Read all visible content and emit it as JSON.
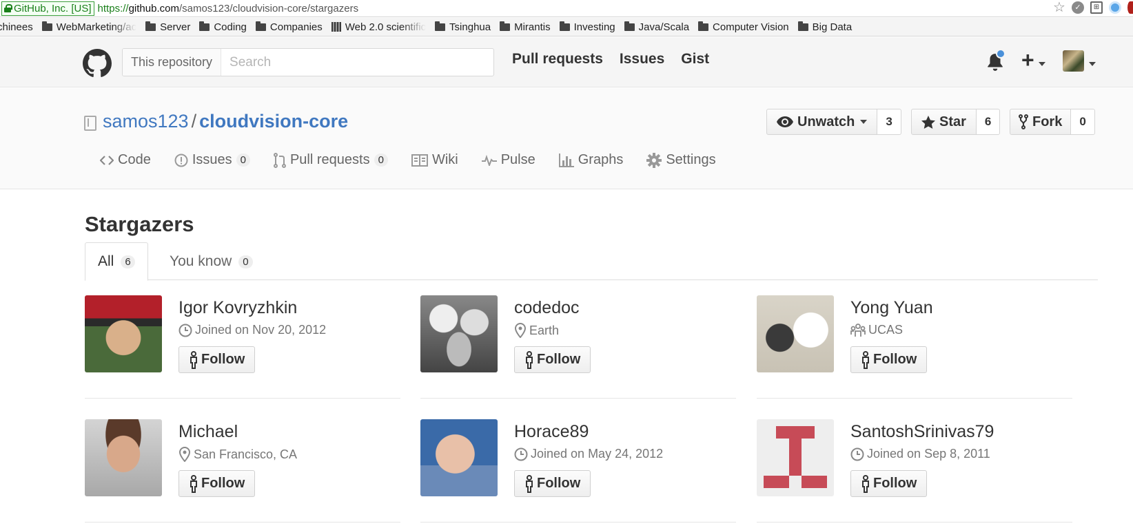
{
  "browser": {
    "secure_label": "GitHub, Inc. [US]",
    "url_scheme": "https://",
    "url_host": "github.com",
    "url_path": "/samos123/cloudvision-core/stargazers",
    "bookmarks": [
      "chinees",
      "WebMarketing/ac",
      "Server",
      "Coding",
      "Companies",
      "Web 2.0 scientific",
      "Tsinghua",
      "Mirantis",
      "Investing",
      "Java/Scala",
      "Computer Vision",
      "Big Data"
    ]
  },
  "header": {
    "search_scope": "This repository",
    "search_placeholder": "Search",
    "nav": [
      "Pull requests",
      "Issues",
      "Gist"
    ],
    "plus_label": "+"
  },
  "repo": {
    "owner": "samos123",
    "separator": "/",
    "name": "cloudvision-core",
    "watch_label": "Unwatch",
    "watch_count": "3",
    "star_label": "Star",
    "star_count": "6",
    "fork_label": "Fork",
    "fork_count": "0",
    "tabs": {
      "code": "Code",
      "issues": "Issues",
      "issues_count": "0",
      "pulls": "Pull requests",
      "pulls_count": "0",
      "wiki": "Wiki",
      "pulse": "Pulse",
      "graphs": "Graphs",
      "settings": "Settings"
    }
  },
  "stargazers": {
    "title": "Stargazers",
    "tab_all": "All",
    "tab_all_count": "6",
    "tab_known": "You know",
    "tab_known_count": "0",
    "follow_label": "Follow",
    "users": [
      {
        "name": "Igor Kovryzhkin",
        "meta": "Joined on Nov 20, 2012",
        "meta_icon": "clock-icon"
      },
      {
        "name": "codedoc",
        "meta": "Earth",
        "meta_icon": "location-icon"
      },
      {
        "name": "Yong Yuan",
        "meta": "UCAS",
        "meta_icon": "organization-icon"
      },
      {
        "name": "Michael",
        "meta": "San Francisco, CA",
        "meta_icon": "location-icon"
      },
      {
        "name": "Horace89",
        "meta": "Joined on May 24, 2012",
        "meta_icon": "clock-icon"
      },
      {
        "name": "SantoshSrinivas79",
        "meta": "Joined on Sep 8, 2011",
        "meta_icon": "clock-icon"
      }
    ]
  },
  "colors": {
    "link": "#4078c0",
    "notification_dot": "#4a90d9",
    "secure_green": "#1a7f1a"
  }
}
